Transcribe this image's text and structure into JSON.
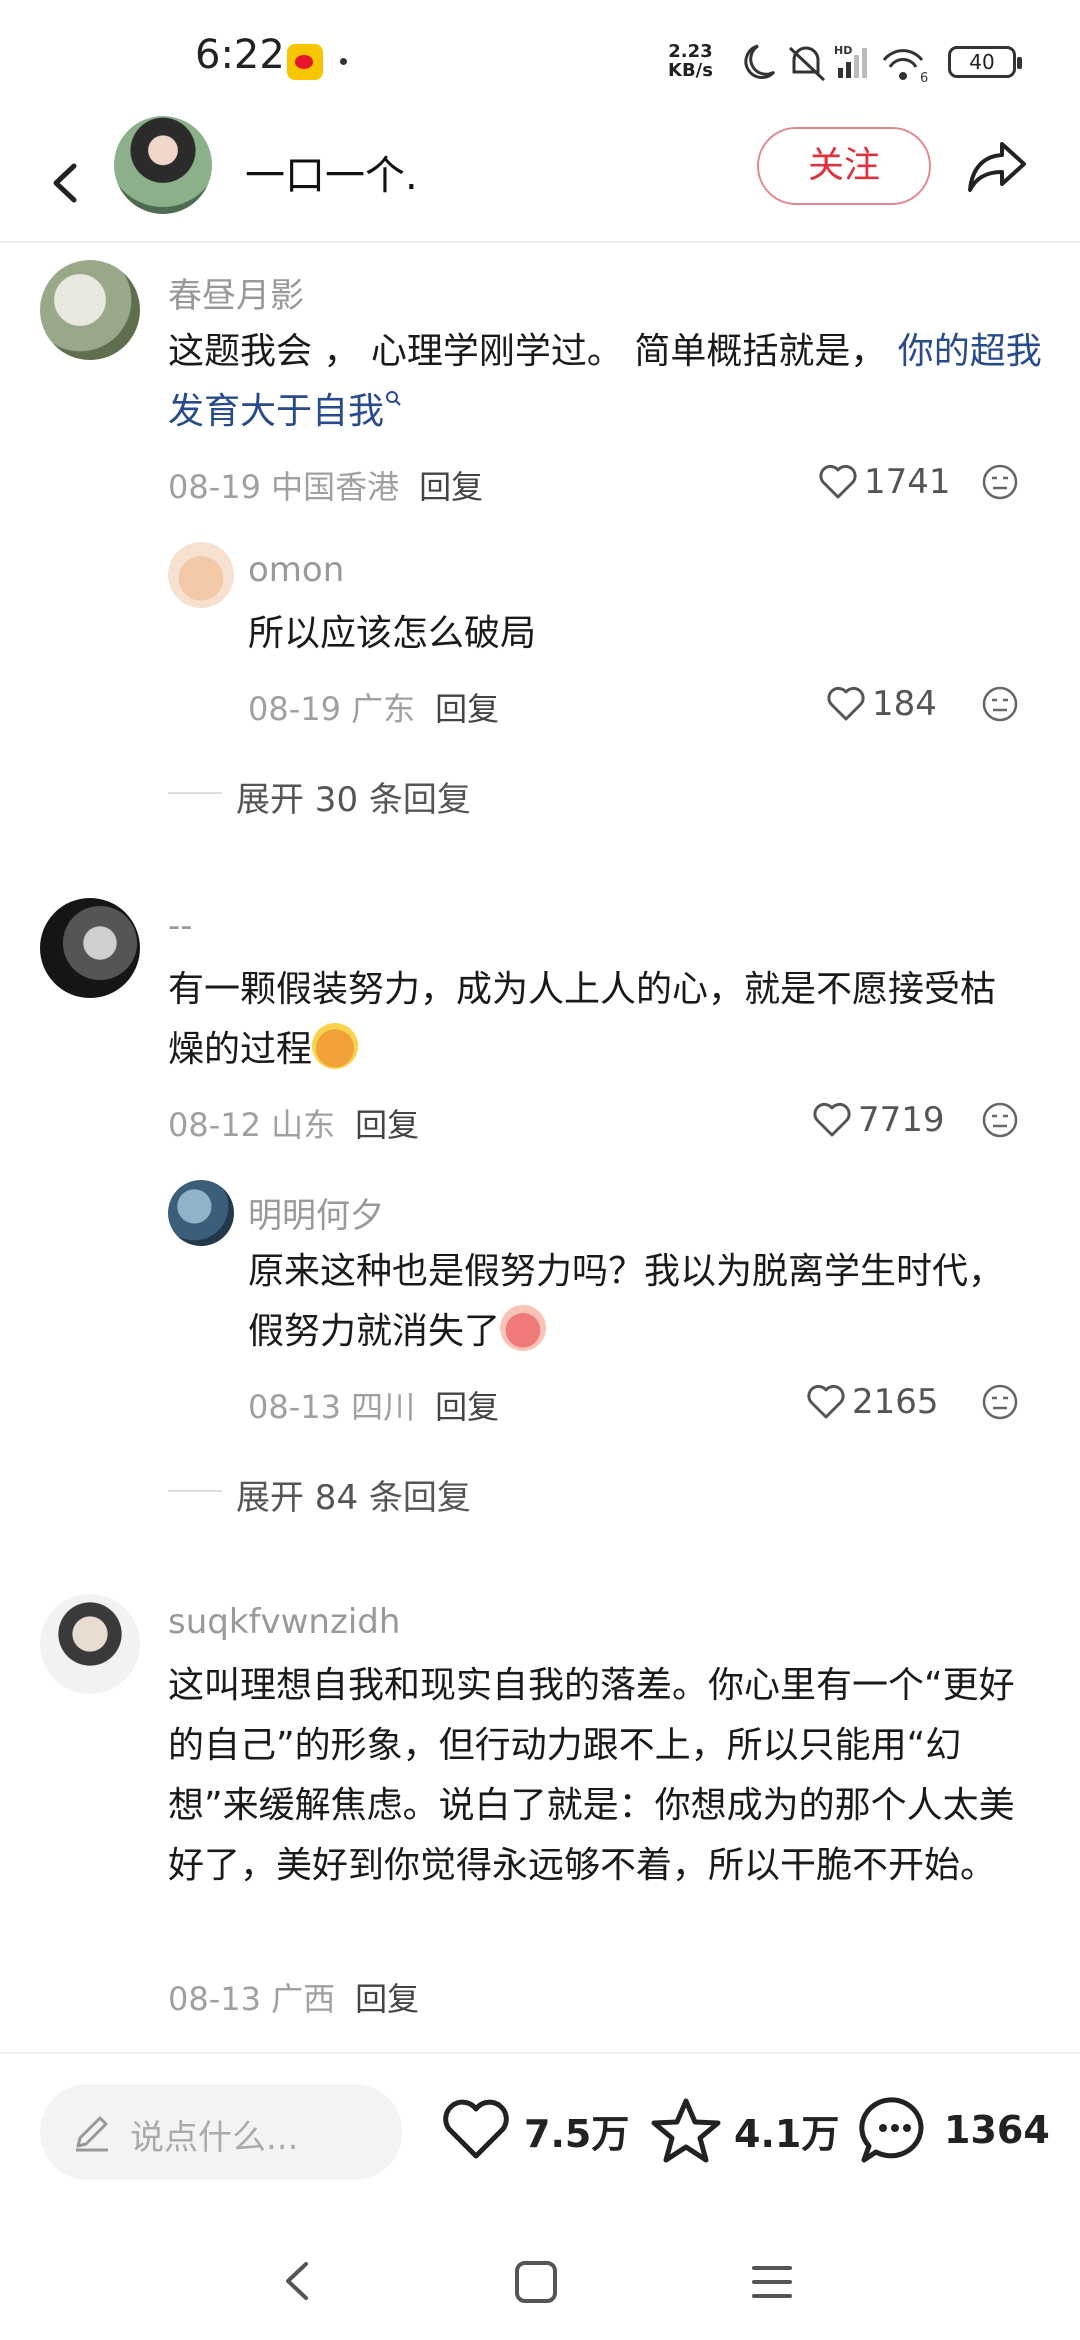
{
  "status_bar": {
    "time": "6:22",
    "net_speed_value": "2.23",
    "net_speed_unit": "KB/s",
    "battery": "40",
    "icons": [
      "weibo-app-icon",
      "moon-icon",
      "mute-bell-icon",
      "hd-signal-icon",
      "wifi-6-icon",
      "battery-icon"
    ]
  },
  "header": {
    "title": "一口一个.",
    "follow_label": "关注",
    "icons": [
      "back-chevron-icon",
      "share-arrow-icon"
    ]
  },
  "comments": [
    {
      "username": "春昼月影",
      "text_plain": "这题我会 ， 心理学刚学过。 简单概括就是， ",
      "text_link": "你的超我发育大于自我",
      "date": "08-19",
      "location": "中国香港",
      "reply_label": "回复",
      "likes": "1741",
      "replies": [
        {
          "username": "omon",
          "text": "所以应该怎么破局",
          "date": "08-19",
          "location": "广东",
          "reply_label": "回复",
          "likes": "184"
        }
      ],
      "expand_label": "展开 30 条回复"
    },
    {
      "username": "--",
      "text": "有一颗假装努力，成为人上人的心，就是不愿接受枯燥的过程",
      "date": "08-12",
      "location": "山东",
      "reply_label": "回复",
      "likes": "7719",
      "replies": [
        {
          "username": "明明何夕",
          "text": "原来这种也是假努力吗？我以为脱离学生时代，假努力就消失了",
          "date": "08-13",
          "location": "四川",
          "reply_label": "回复",
          "likes": "2165"
        }
      ],
      "expand_label": "展开 84 条回复"
    },
    {
      "username": "suqkfvwnzidh",
      "text": "这叫理想自我和现实自我的落差。你心里有一个“更好的自己”的形象，但行动力跟不上，所以只能用“幻想”来缓解焦虑。说白了就是：你想成为的那个人太美好了，美好到你觉得永远够不着，所以干脆不开始。",
      "date": "08-13",
      "location": "广西",
      "reply_label": "回复"
    }
  ],
  "bottom_bar": {
    "input_placeholder": "说点什么...",
    "likes": "7.5万",
    "favorites": "4.1万",
    "comments": "1364"
  },
  "colors": {
    "follow_red": "#e0323c",
    "link_blue": "#274b8c",
    "muted_gray": "#999999"
  }
}
